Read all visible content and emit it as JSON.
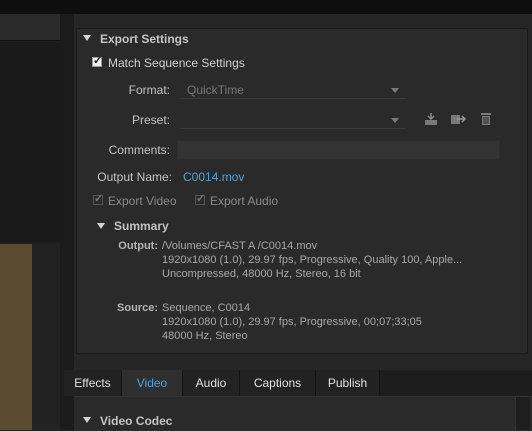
{
  "export_settings": {
    "title": "Export Settings",
    "match_sequence_label": "Match Sequence Settings",
    "match_sequence_checked": true,
    "format_label": "Format:",
    "format_value": "QuickTime",
    "preset_label": "Preset:",
    "preset_value": "",
    "comments_label": "Comments:",
    "comments_value": "",
    "output_name_label": "Output Name:",
    "output_name_value": "C0014.mov",
    "export_video_label": "Export Video",
    "export_audio_label": "Export Audio",
    "icons": [
      "save-preset-icon",
      "import-preset-icon",
      "delete-preset-icon"
    ]
  },
  "summary": {
    "title": "Summary",
    "output_label": "Output:",
    "output_lines": [
      "/Volumes/CFAST A /C0014.mov",
      "1920x1080 (1.0), 29.97 fps, Progressive, Quality 100, Apple...",
      "Uncompressed, 48000 Hz, Stereo, 16 bit"
    ],
    "source_label": "Source:",
    "source_lines": [
      "Sequence, C0014",
      "1920x1080 (1.0), 29.97 fps, Progressive, 00;07;33;05",
      "48000 Hz, Stereo"
    ]
  },
  "tabs": [
    {
      "label": "Effects",
      "active": false
    },
    {
      "label": "Video",
      "active": true
    },
    {
      "label": "Audio",
      "active": false
    },
    {
      "label": "Captions",
      "active": false
    },
    {
      "label": "Publish",
      "active": false
    }
  ],
  "video_codec": {
    "title": "Video Codec"
  },
  "colors": {
    "accent": "#4aa3dc",
    "panel": "#2a2a2a"
  }
}
